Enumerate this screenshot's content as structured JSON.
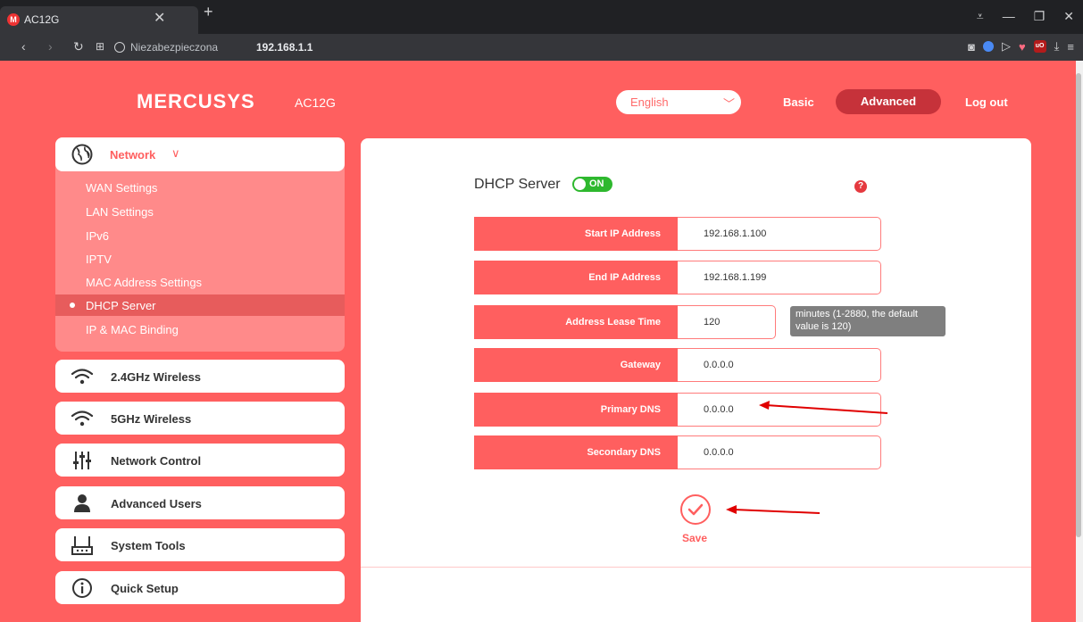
{
  "browser": {
    "tab_title": "AC12G",
    "tab_favicon": "M",
    "url_security": "Niezabezpieczona",
    "url_host": "192.168.1.1",
    "icons": [
      "back-icon",
      "forward-icon",
      "reload-icon",
      "speed-dial-icon",
      "globe-icon",
      "camera-icon",
      "shield-icon",
      "send-icon",
      "heart-icon",
      "ublock-icon",
      "download-icon",
      "menu-icon"
    ]
  },
  "header": {
    "logo": "MERCUSYS",
    "model": "AC12G",
    "language": "English",
    "nav_basic": "Basic",
    "nav_advanced": "Advanced",
    "nav_logout": "Log out"
  },
  "sidebar": {
    "network": {
      "label": "Network",
      "items": [
        "WAN Settings",
        "LAN Settings",
        "IPv6",
        "IPTV",
        "MAC Address Settings",
        "DHCP Server",
        "IP & MAC Binding"
      ],
      "active_index": 5
    },
    "menus": [
      {
        "label": "2.4GHz Wireless",
        "icon": "wifi-icon"
      },
      {
        "label": "5GHz Wireless",
        "icon": "wifi-icon"
      },
      {
        "label": "Network Control",
        "icon": "sliders-icon"
      },
      {
        "label": "Advanced Users",
        "icon": "user-icon"
      },
      {
        "label": "System Tools",
        "icon": "router-icon"
      },
      {
        "label": "Quick Setup",
        "icon": "info-icon"
      }
    ]
  },
  "dhcp": {
    "title": "DHCP Server",
    "toggle": "ON",
    "enabled": true,
    "help": "?",
    "fields": [
      {
        "label": "Start IP Address",
        "value": "192.168.1.100"
      },
      {
        "label": "End IP Address",
        "value": "192.168.1.199"
      },
      {
        "label": "Address Lease Time",
        "value": "120"
      },
      {
        "label": "Gateway",
        "value": "0.0.0.0"
      },
      {
        "label": "Primary DNS",
        "value": "0.0.0.0"
      },
      {
        "label": "Secondary DNS",
        "value": "0.0.0.0"
      }
    ],
    "lease_hint": "minutes (1-2880, the default value is 120)",
    "save": "Save"
  },
  "colors": {
    "brand": "#ff5f5f",
    "active_nav": "#c6323a",
    "toggle_on": "#2eb82e",
    "annotation_arrow": "#e00000"
  }
}
